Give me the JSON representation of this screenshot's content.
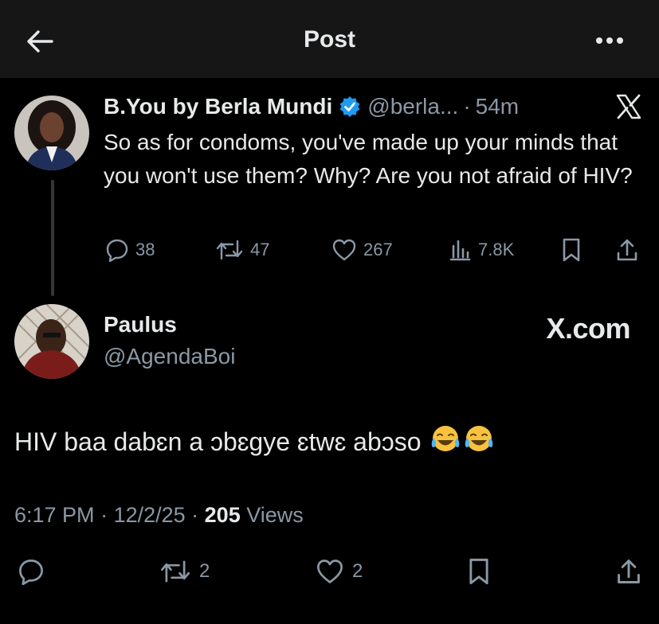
{
  "header": {
    "title": "Post"
  },
  "quoted": {
    "name": "B.You by Berla Mundi",
    "handle": "@berla...",
    "dot": "·",
    "time": "54m",
    "text": "So as for condoms, you've made up your minds that you won't use them? Why? Are you not afraid of HIV?",
    "replies": "38",
    "reposts": "47",
    "likes": "267",
    "views": "7.8K"
  },
  "post": {
    "name": "Paulus",
    "handle": "@AgendaBoi",
    "watermark": "X.com",
    "text": "HIV baa dabɛn a ɔbɛgye ɛtwɛ abɔso",
    "time": "6:17 PM",
    "sep1": " · ",
    "date": "12/2/25",
    "sep2": " · ",
    "views_count": "205",
    "views_label": " Views",
    "reposts": "2",
    "likes": "2"
  },
  "colors": {
    "accent": "#1d9bf0",
    "muted": "#8b98a5",
    "text": "#e7e9ea"
  },
  "icons": [
    "back-arrow-icon",
    "more-icon",
    "verified-badge-icon",
    "x-logo-icon",
    "reply-icon",
    "repost-icon",
    "like-icon",
    "views-icon",
    "bookmark-icon",
    "share-icon",
    "tears-of-joy-emoji"
  ]
}
